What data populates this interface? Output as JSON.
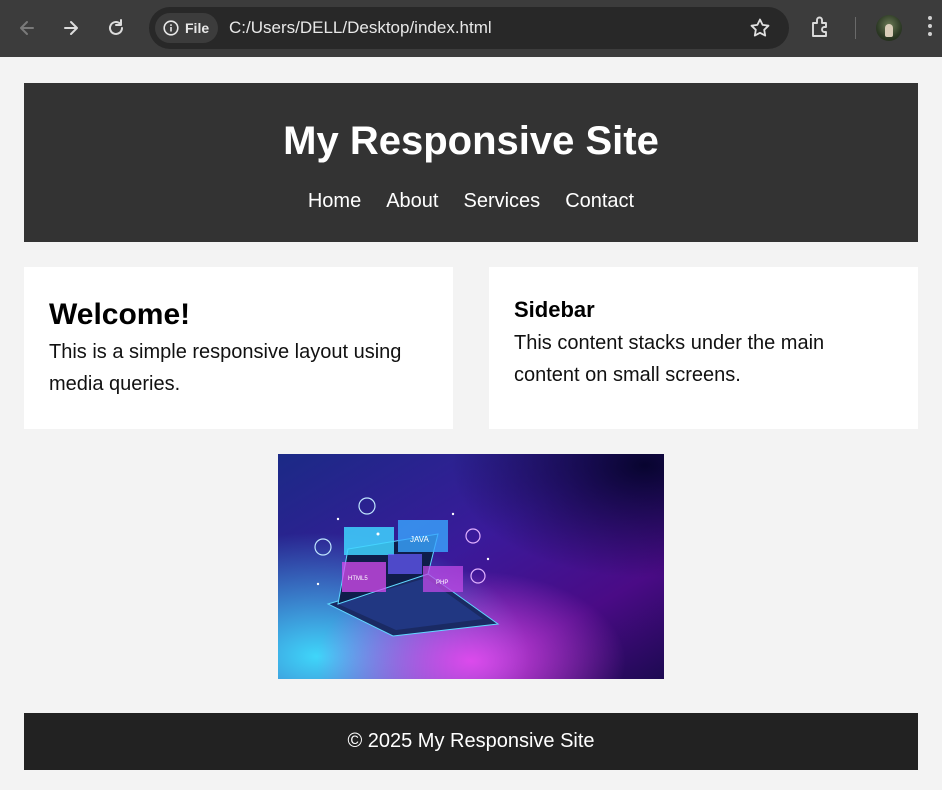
{
  "browser": {
    "chip_label": "File",
    "url": "C:/Users/DELL/Desktop/index.html",
    "icons": [
      "back-icon",
      "forward-icon",
      "reload-icon",
      "info-icon",
      "star-icon",
      "extensions-icon",
      "avatar",
      "menu-icon"
    ]
  },
  "site": {
    "title": "My Responsive Site",
    "nav": [
      "Home",
      "About",
      "Services",
      "Contact"
    ]
  },
  "main": {
    "heading": "Welcome!",
    "text": "This is a simple responsive layout using media queries."
  },
  "sidebar": {
    "heading": "Sidebar",
    "text": "This content stacks under the main content on small screens."
  },
  "hero_image": {
    "labels": [
      "JAVA",
      "HTML5",
      "PHP"
    ]
  },
  "footer": {
    "text": "© 2025 My Responsive Site"
  },
  "colors": {
    "chrome": "#3c3c3c",
    "omnibox": "#282828",
    "header_bg": "#333333",
    "footer_bg": "#222222",
    "page_bg": "#f3f3f3"
  }
}
